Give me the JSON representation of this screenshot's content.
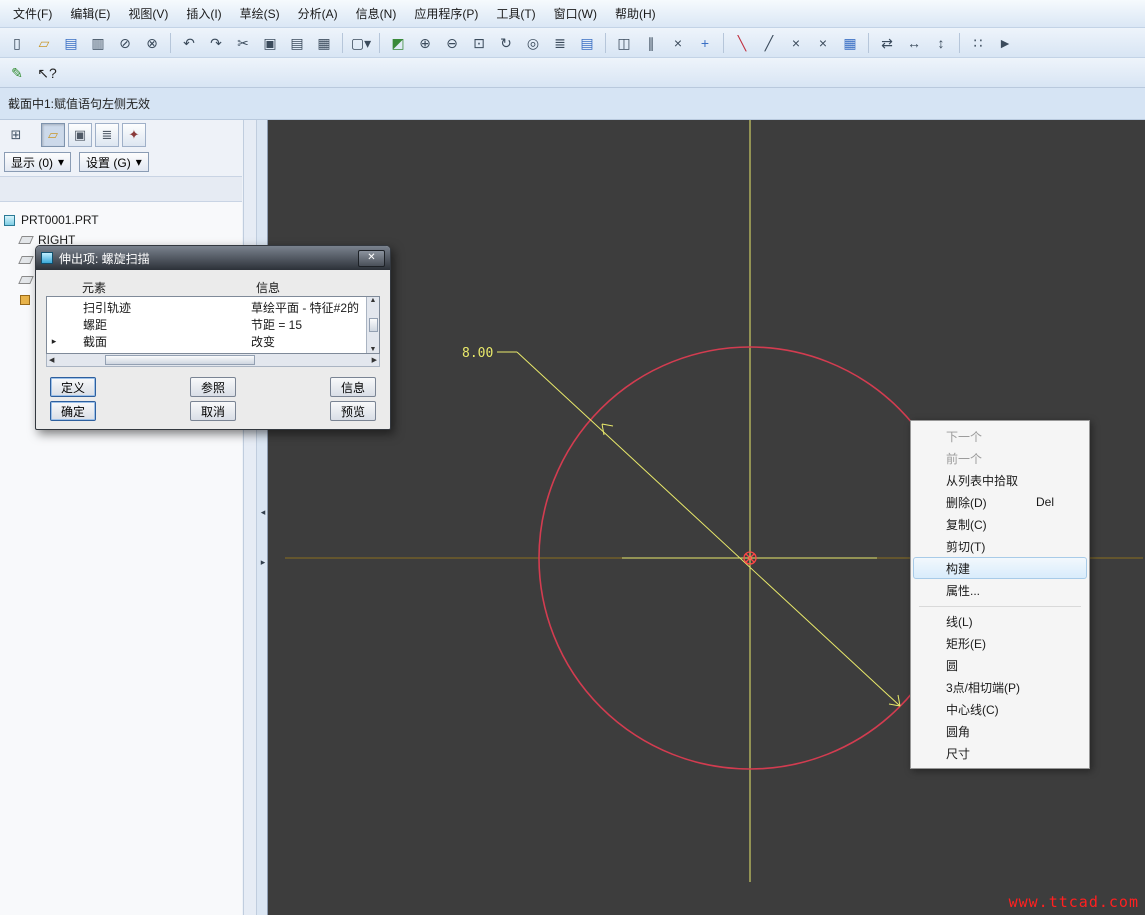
{
  "menu_bar": {
    "items": [
      {
        "name": "file",
        "label": "文件(F)"
      },
      {
        "name": "edit",
        "label": "编辑(E)"
      },
      {
        "name": "view",
        "label": "视图(V)"
      },
      {
        "name": "insert",
        "label": "插入(I)"
      },
      {
        "name": "sketch",
        "label": "草绘(S)"
      },
      {
        "name": "analysis",
        "label": "分析(A)"
      },
      {
        "name": "info",
        "label": "信息(N)"
      },
      {
        "name": "applications",
        "label": "应用程序(P)"
      },
      {
        "name": "tools",
        "label": "工具(T)"
      },
      {
        "name": "window",
        "label": "窗口(W)"
      },
      {
        "name": "help",
        "label": "帮助(H)"
      }
    ]
  },
  "toolbar": {
    "icons": [
      {
        "name": "new-file",
        "glyph": "▯"
      },
      {
        "name": "open-folder",
        "glyph": "▱",
        "color": "#c8972a"
      },
      {
        "name": "save",
        "glyph": "▤",
        "color": "#3a6fc4"
      },
      {
        "name": "print",
        "glyph": "▥"
      },
      {
        "name": "erase-display",
        "glyph": "⊘"
      },
      {
        "name": "delete-old-versions",
        "glyph": "⊗"
      },
      {
        "separator": true
      },
      {
        "name": "undo",
        "glyph": "↶"
      },
      {
        "name": "redo",
        "glyph": "↷"
      },
      {
        "name": "cut",
        "glyph": "✂"
      },
      {
        "name": "copy",
        "glyph": "▣"
      },
      {
        "name": "paste",
        "glyph": "▤"
      },
      {
        "name": "paste-special",
        "glyph": "▦"
      },
      {
        "separator": true
      },
      {
        "name": "select-rect",
        "glyph": "▢▾"
      },
      {
        "separator": true
      },
      {
        "name": "sketch-orient",
        "glyph": "◩",
        "color": "#3a8a3a"
      },
      {
        "name": "zoom-in",
        "glyph": "⊕"
      },
      {
        "name": "zoom-out",
        "glyph": "⊖"
      },
      {
        "name": "zoom-fit",
        "glyph": "⊡"
      },
      {
        "name": "repaint",
        "glyph": "↻"
      },
      {
        "name": "find",
        "glyph": "◎"
      },
      {
        "name": "layers",
        "glyph": "≣"
      },
      {
        "name": "view-manager",
        "glyph": "▤",
        "color": "#3a6fc4"
      },
      {
        "separator": true
      },
      {
        "name": "datum-plane-toggle",
        "glyph": "◫"
      },
      {
        "name": "datum-axis-toggle",
        "glyph": "∥"
      },
      {
        "name": "datum-point-toggle",
        "glyph": "×"
      },
      {
        "name": "csys-toggle",
        "glyph": "+",
        "color": "#3a6fc4"
      },
      {
        "separator": true
      },
      {
        "name": "sketch-line-red",
        "glyph": "╲",
        "color": "#c03040"
      },
      {
        "name": "sketch-line",
        "glyph": "╱"
      },
      {
        "name": "delete-segment",
        "glyph": "×"
      },
      {
        "name": "divide-segment",
        "glyph": "×"
      },
      {
        "name": "modify-values",
        "glyph": "▦",
        "color": "#3a6fc4"
      },
      {
        "separator": true
      },
      {
        "name": "swap-view",
        "glyph": "⇄"
      },
      {
        "name": "fit-width",
        "glyph": "↔"
      },
      {
        "name": "fit-height",
        "glyph": "↕"
      },
      {
        "separator": true
      },
      {
        "name": "grid-dots",
        "glyph": "∷"
      },
      {
        "name": "next-page",
        "glyph": "►"
      }
    ]
  },
  "toolbar2": {
    "icons": [
      {
        "name": "sketcher-pencil",
        "glyph": "✎",
        "color": "#2e8b2e"
      },
      {
        "name": "context-help",
        "glyph": "↖?",
        "color": "#222222"
      }
    ]
  },
  "message_bar": {
    "text": "截面中1:赋值语句左侧无效"
  },
  "model_tree_panel": {
    "header_icons": [
      {
        "name": "tree-columns",
        "glyph": "⊞",
        "color": "#445566",
        "plain": true
      },
      {
        "name": "folder-browser",
        "glyph": "▱",
        "color": "#c8972a",
        "pressed": true
      },
      {
        "name": "favorites",
        "glyph": "▣",
        "color": "#505a66"
      },
      {
        "name": "layer-tree",
        "glyph": "≣",
        "color": "#505a66"
      },
      {
        "name": "lock",
        "glyph": "✦",
        "color": "#8a3a3a"
      }
    ],
    "dropdown_caret": "▾",
    "dropdowns": [
      {
        "name": "show",
        "label": "显示 (0)"
      },
      {
        "name": "settings",
        "label": "设置 (G)"
      }
    ],
    "tree": [
      {
        "name": "part-root",
        "icon": "part",
        "label": "PRT0001.PRT",
        "level": 0
      },
      {
        "name": "datum-right",
        "icon": "plane",
        "label": "RIGHT",
        "level": 1
      },
      {
        "icon": "plane",
        "label": "",
        "level": 1
      },
      {
        "icon": "plane",
        "label": "",
        "level": 1
      },
      {
        "icon": "feature",
        "label": "",
        "level": 1
      }
    ]
  },
  "dialog": {
    "title": "伸出项: 螺旋扫描",
    "close_label": "✕",
    "columns": {
      "element": "元素",
      "info": "信息"
    },
    "rows": [
      {
        "name": "trajectory",
        "element": "扫引轨迹",
        "info": "草绘平面 - 特征#2的"
      },
      {
        "name": "pitch",
        "element": "螺距",
        "info": "节距 = 15"
      },
      {
        "name": "section",
        "element": "截面",
        "info": "改变",
        "marker": "▸",
        "current": true
      }
    ],
    "scroll_glyphs": {
      "up": "▲",
      "down": "▼",
      "left": "◀",
      "right": "▶"
    },
    "buttons": {
      "define": "定义",
      "refs": "参照",
      "info": "信息",
      "ok": "确定",
      "cancel": "取消",
      "preview": "预览"
    }
  },
  "context_menu": {
    "items": [
      {
        "name": "next",
        "label": "下一个",
        "disabled": true
      },
      {
        "name": "previous",
        "label": "前一个",
        "disabled": true
      },
      {
        "name": "pick-from-list",
        "label": "从列表中拾取"
      },
      {
        "name": "delete",
        "label": "删除(D)",
        "shortcut": "Del"
      },
      {
        "name": "copy",
        "label": "复制(C)"
      },
      {
        "name": "cut",
        "label": "剪切(T)"
      },
      {
        "name": "construct",
        "label": "构建",
        "highlighted": true
      },
      {
        "name": "properties",
        "label": "属性..."
      },
      {
        "separator": true
      },
      {
        "name": "line",
        "label": "线(L)"
      },
      {
        "name": "rectangle",
        "label": "矩形(E)"
      },
      {
        "name": "circle",
        "label": "圆"
      },
      {
        "name": "3point-tangent",
        "label": "3点/相切端(P)"
      },
      {
        "name": "centerline",
        "label": "中心线(C)"
      },
      {
        "name": "fillet",
        "label": "圆角"
      },
      {
        "name": "dimension",
        "label": "尺寸"
      }
    ]
  },
  "canvas": {
    "dimension_label": "8.00",
    "colors": {
      "background": "#3d3d3d",
      "centerline": "#e9e96a",
      "centerline_dim": "#8a6f20",
      "circle": "#d33c50",
      "center_marker": "#ff4646",
      "dimension_text": "#e9e96a"
    }
  },
  "watermark": {
    "text": "www.ttcad.com",
    "color": "#ff2020"
  }
}
